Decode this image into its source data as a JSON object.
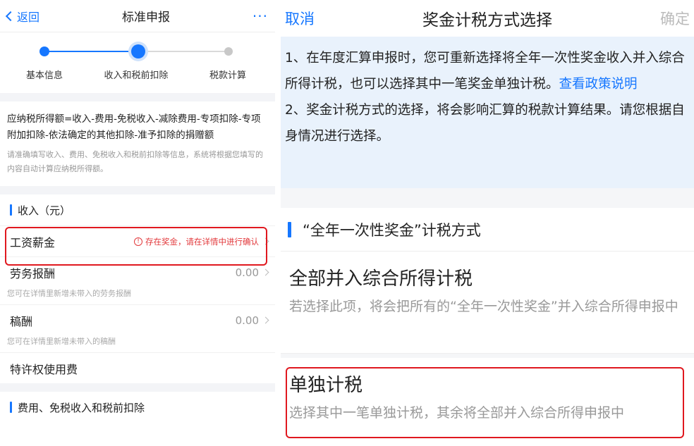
{
  "left": {
    "nav": {
      "back": "返回",
      "title": "标准申报",
      "more": "···"
    },
    "steps": [
      {
        "label": "基本信息"
      },
      {
        "label": "收入和税前扣除"
      },
      {
        "label": "税款计算"
      }
    ],
    "formula": {
      "main": "应纳税所得额=收入-费用-免税收入-减除费用-专项扣除-专项附加扣除-依法确定的其他扣除-准予扣除的捐赠额",
      "hint": "请准确填写收入、费用、免税收入和税前扣除等信息，系统将根据您填写的内容自动计算应纳税所得额。"
    },
    "income_title": "收入（元）",
    "rows": {
      "salary": {
        "name": "工资薪金",
        "warning": "存在奖金，请在详情中进行确认"
      },
      "labor": {
        "name": "劳务报酬",
        "value": "0.00",
        "hint": "您可在详情里新增未带入的劳务报酬"
      },
      "royalty": {
        "name": "稿酬",
        "value": "0.00",
        "hint": "您可在详情里新增未带入的稿酬"
      },
      "license": {
        "name": "特许权使用费"
      }
    },
    "deduction_title": "费用、免税收入和税前扣除"
  },
  "right": {
    "nav": {
      "cancel": "取消",
      "title": "奖金计税方式选择",
      "confirm": "确定"
    },
    "notice": {
      "p1": "1、在年度汇算申报时，您可重新选择将全年一次性奖金收入并入综合所得计税，也可以选择其中一笔奖金单独计税。",
      "link": "查看政策说明",
      "p2": "2、奖金计税方式的选择，将会影响汇算的税款计算结果。请您根据自身情况进行选择。"
    },
    "section_title": "“全年一次性奖金”计税方式",
    "options": [
      {
        "title": "全部并入综合所得计税",
        "desc": "若选择此项，将会把所有的“全年一次性奖金”并入综合所得申报中"
      },
      {
        "title": "单独计税",
        "desc": "选择其中一笔单独计税，其余将全部并入综合所得申报中"
      }
    ]
  },
  "colors": {
    "accent": "#1677ff",
    "warning": "#e2393c",
    "highlight": "#e0181f",
    "notice_bg": "#e9f2fc"
  }
}
